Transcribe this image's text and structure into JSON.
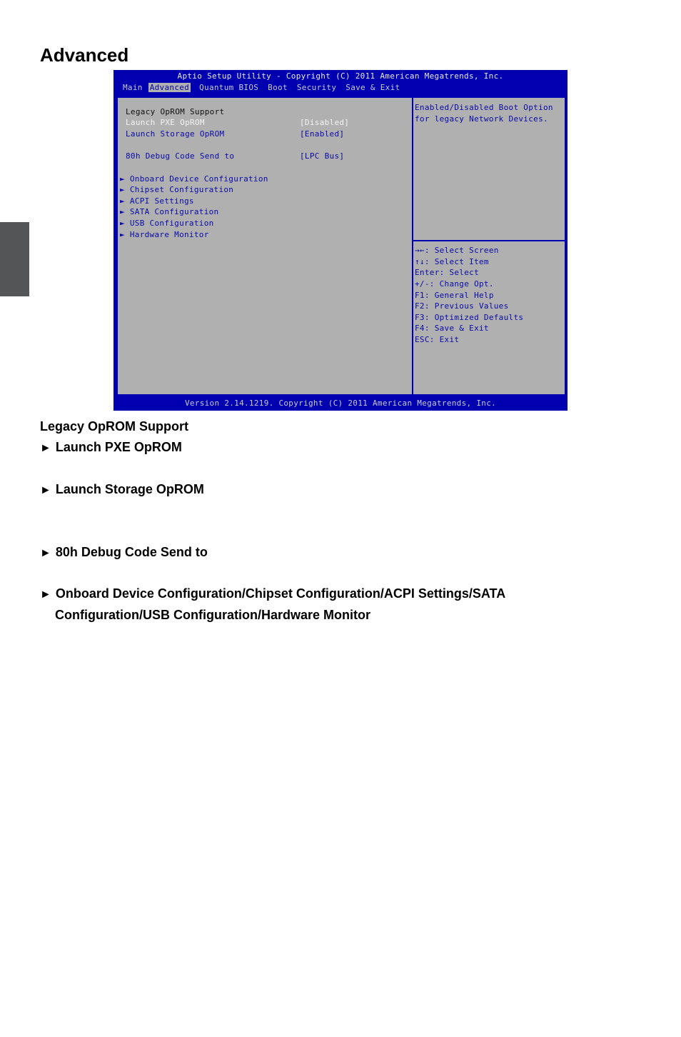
{
  "page": {
    "title": "Advanced"
  },
  "bios": {
    "title": "Aptio Setup Utility - Copyright (C) 2011 American Megatrends, Inc.",
    "menu_tabs": [
      "Main",
      "Advanced",
      "Quantum BIOS",
      "Boot",
      "Security",
      "Save & Exit"
    ],
    "active_tab": "Advanced",
    "section_heading": "Legacy OpROM Support",
    "settings": [
      {
        "label": "Launch PXE OpROM",
        "value": "[Disabled]",
        "selected": true
      },
      {
        "label": "Launch Storage OpROM",
        "value": "[Enabled]",
        "selected": false
      },
      {
        "label": "80h Debug Code Send to",
        "value": "[LPC Bus]",
        "selected": false
      }
    ],
    "submenus": [
      "Onboard Device Configuration",
      "Chipset Configuration",
      "ACPI Settings",
      "SATA Configuration",
      "USB Configuration",
      "Hardware Monitor"
    ],
    "help_text": [
      "Enabled/Disabled Boot Option",
      "for legacy Network Devices."
    ],
    "key_help": [
      "→←: Select Screen",
      "↑↓: Select Item",
      "Enter: Select",
      "+/-: Change Opt.",
      "F1: General Help",
      "F2: Previous Values",
      "F3: Optimized Defaults",
      "F4: Save & Exit",
      "ESC: Exit"
    ],
    "footer": "Version 2.14.1219. Copyright (C) 2011 American Megatrends, Inc.",
    "colors": {
      "frame": "#0000b0",
      "panel": "#b0b0b0",
      "text_blue": "#0a0aa8",
      "selected": "#f4f4f4"
    }
  },
  "doc": {
    "heading": "Legacy OpROM Support",
    "items": [
      "Launch PXE OpROM",
      "Launch Storage OpROM",
      "80h Debug Code Send to",
      "Onboard Device Configuration/Chipset Configuration/ACPI Settings/SATA",
      "Configuration/USB Configuration/Hardware Monitor"
    ],
    "arrow": "►"
  }
}
